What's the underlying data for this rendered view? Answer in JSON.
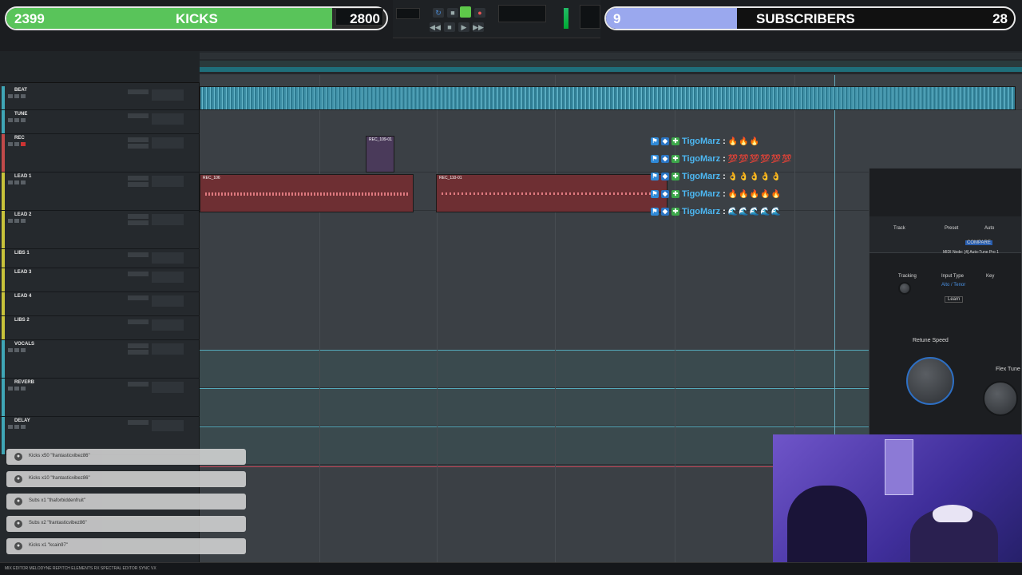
{
  "goals": {
    "kicks": {
      "current": "2399",
      "label": "KICKS",
      "target": "2800",
      "progress": 0.857
    },
    "subs": {
      "current": "9",
      "label": "SUBSCRIBERS",
      "target": "28",
      "progress": 0.32
    }
  },
  "tracks": [
    {
      "name": "BEAT",
      "color": "#3fa6b6"
    },
    {
      "name": "TUNE",
      "color": "#3fa6b6"
    },
    {
      "name": "REC",
      "color": "#c04a4a"
    },
    {
      "name": "LEAD 1",
      "color": "#c8c23a"
    },
    {
      "name": "LEAD 2",
      "color": "#c8c23a"
    },
    {
      "name": "LIBS 1",
      "color": "#c8c23a"
    },
    {
      "name": "LEAD 3",
      "color": "#c8c23a"
    },
    {
      "name": "LEAD 4",
      "color": "#c8c23a"
    },
    {
      "name": "LIBS 2",
      "color": "#c8c23a"
    },
    {
      "name": "VOCALS",
      "color": "#3fa6b6"
    },
    {
      "name": "REVERB",
      "color": "#3fa6b6"
    },
    {
      "name": "DELAY",
      "color": "#3fa6b6"
    }
  ],
  "clips": {
    "rec": "REC_109-01",
    "lead_a": "REC_106",
    "lead_b": "REC_110-01"
  },
  "chat": [
    {
      "user": "TigoMarz",
      "msg": "🔥🔥🔥"
    },
    {
      "user": "TigoMarz",
      "msg": "💯💯💯💯💯💯"
    },
    {
      "user": "TigoMarz",
      "msg": "👌👌👌👌👌"
    },
    {
      "user": "TigoMarz",
      "msg": "🔥🔥🔥🔥🔥"
    },
    {
      "user": "TigoMarz",
      "msg": "🌊🌊🌊🌊🌊"
    }
  ],
  "alerts": [
    "Kicks x50 \"frantasticvibez86\"",
    "Kicks x10 \"frantasticvibez86\"",
    "Subs x1 \"thaforbiddenfruit\"",
    "Subs x2 \"frantasticvibez86\"",
    "Kicks x1 \"kcain97\""
  ],
  "plugin": {
    "track": "Track",
    "preset": "Preset",
    "auto": "Auto",
    "tracking": "Tracking",
    "input_type": "Input Type",
    "input_value": "Alto / Tenor",
    "key": "Key",
    "learn": "Learn",
    "retune": "Retune Speed",
    "flex": "Flex Tune",
    "compare": "COMPARE",
    "plugin_name": "MIDI Node: [4] Auto-Tune Pro 1"
  },
  "bottom": "MIX EDITOR   MELODYNE   REPITCH ELEMENTS   RX SPECTRAL EDITOR   SYNC VX",
  "colors": {
    "kicks": "#59c45a",
    "subs": "#9aa8ee",
    "audio": "#3e8fa6",
    "rec": "#8a3a3a"
  }
}
